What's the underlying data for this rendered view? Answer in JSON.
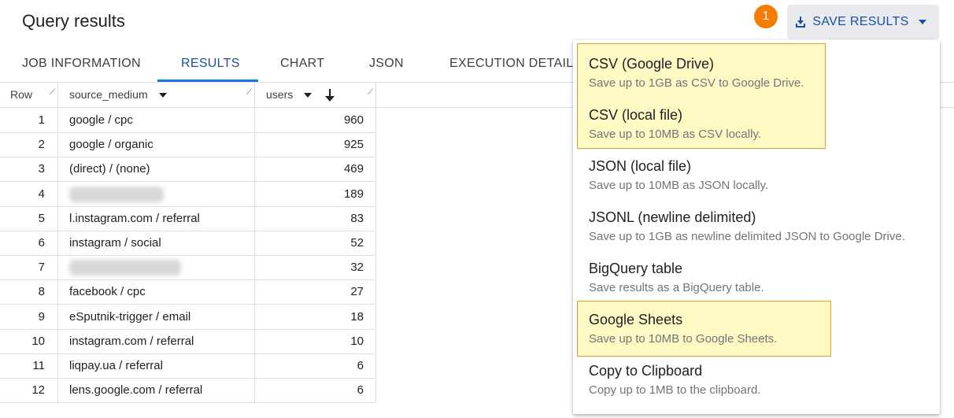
{
  "header": {
    "title": "Query results",
    "badge": "1",
    "save_button_label": "SAVE RESULTS"
  },
  "tabs": [
    {
      "label": "JOB INFORMATION"
    },
    {
      "label": "RESULTS"
    },
    {
      "label": "CHART"
    },
    {
      "label": "JSON"
    },
    {
      "label": "EXECUTION DETAILS"
    }
  ],
  "active_tab": "RESULTS",
  "table": {
    "columns": [
      "Row",
      "source_medium",
      "users"
    ],
    "rows": [
      {
        "row": "1",
        "source_medium": "google / cpc",
        "users": "960"
      },
      {
        "row": "2",
        "source_medium": "google / organic",
        "users": "925"
      },
      {
        "row": "3",
        "source_medium": "(direct) / (none)",
        "users": "469"
      },
      {
        "row": "4",
        "source_medium": "",
        "users": "189"
      },
      {
        "row": "5",
        "source_medium": "l.instagram.com / referral",
        "users": "83"
      },
      {
        "row": "6",
        "source_medium": "instagram / social",
        "users": "52"
      },
      {
        "row": "7",
        "source_medium": "",
        "users": "32"
      },
      {
        "row": "8",
        "source_medium": "facebook / cpc",
        "users": "27"
      },
      {
        "row": "9",
        "source_medium": "eSputnik-trigger / email",
        "users": "18"
      },
      {
        "row": "10",
        "source_medium": "instagram.com / referral",
        "users": "10"
      },
      {
        "row": "11",
        "source_medium": "liqpay.ua / referral",
        "users": "6"
      },
      {
        "row": "12",
        "source_medium": "lens.google.com / referral",
        "users": "6"
      }
    ]
  },
  "save_menu": [
    {
      "title": "CSV (Google Drive)",
      "desc": "Save up to 1GB as CSV to Google Drive.",
      "highlighted": true
    },
    {
      "title": "CSV (local file)",
      "desc": "Save up to 10MB as CSV locally.",
      "highlighted": true
    },
    {
      "title": "JSON (local file)",
      "desc": "Save up to 10MB as JSON locally.",
      "highlighted": false
    },
    {
      "title": "JSONL (newline delimited)",
      "desc": "Save up to 1GB as newline delimited JSON to Google Drive.",
      "highlighted": false
    },
    {
      "title": "BigQuery table",
      "desc": "Save results as a BigQuery table.",
      "highlighted": false
    },
    {
      "title": "Google Sheets",
      "desc": "Save up to 10MB to Google Sheets.",
      "highlighted": true
    },
    {
      "title": "Copy to Clipboard",
      "desc": "Copy up to 1MB to the clipboard.",
      "highlighted": false
    }
  ],
  "colors": {
    "accent": "#1a73e8",
    "button_text": "#1a4fa3",
    "badge": "#f57c00",
    "highlight_fill": "#fff9c4",
    "highlight_border": "#e0a030"
  },
  "icons": {
    "save": "download-icon",
    "dropdown": "caret-down-icon",
    "sort": "arrow-down-icon",
    "resize": "resize-handle-icon"
  }
}
